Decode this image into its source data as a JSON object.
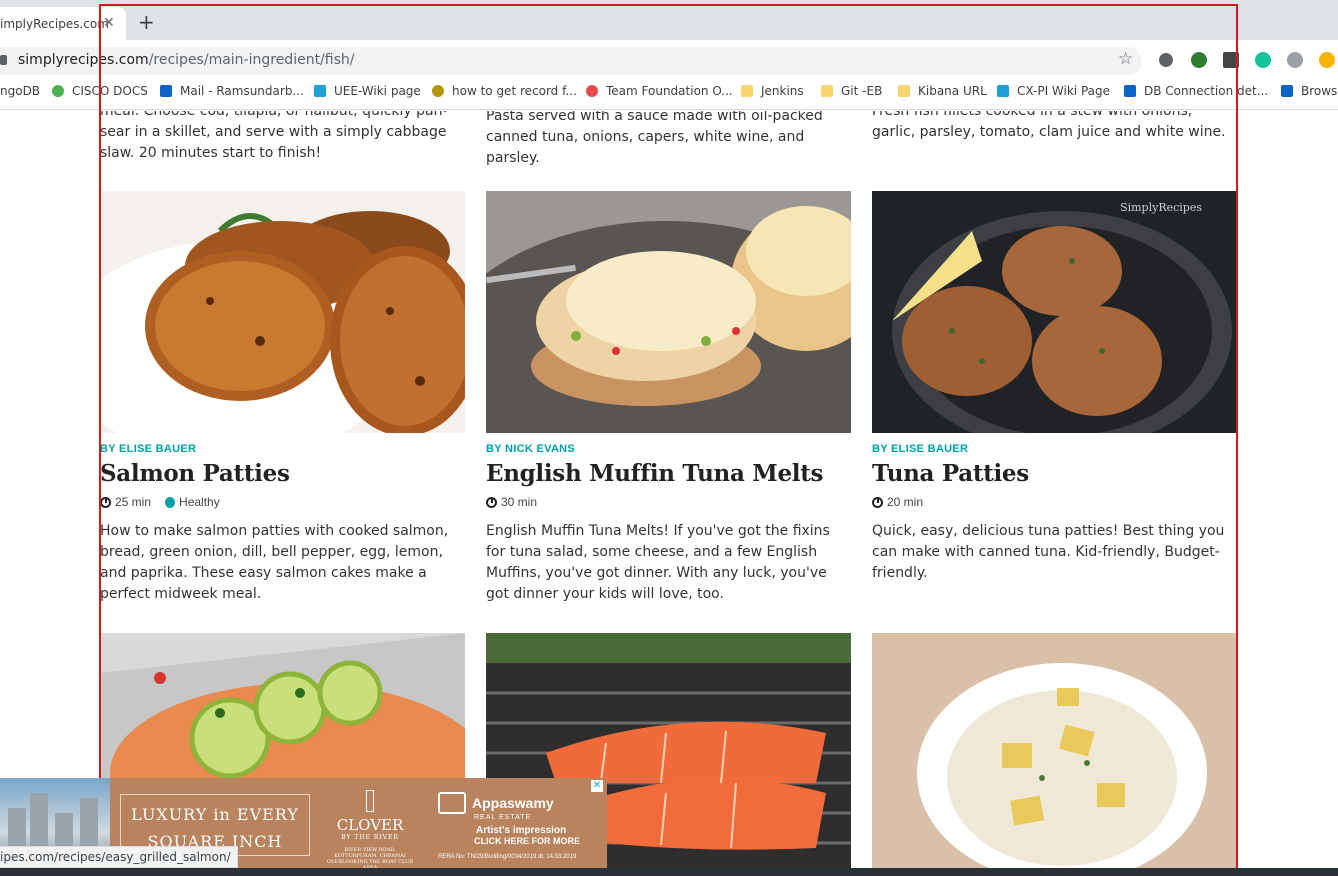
{
  "browser": {
    "tab_title": "implyRecipes.com",
    "tab_close": "✕",
    "new_tab": "+",
    "url_host": "simplyrecipes.com",
    "url_path": "/recipes/main-ingredient/fish/",
    "star": "☆"
  },
  "bookmarks": [
    {
      "label": "ngoDB",
      "color": "#4caf50"
    },
    {
      "label": "CISCO DOCS",
      "color": "#f4b400"
    },
    {
      "label": "Mail - Ramsundarb...",
      "color": "#0a64c8"
    },
    {
      "label": "UEE-Wiki page",
      "color": "#1ba0d7"
    },
    {
      "label": "how to get record f...",
      "color": "#b7950b"
    },
    {
      "label": "Team Foundation O...",
      "color": "#e44b4b"
    },
    {
      "label": "Jenkins",
      "color": "#f9d56e"
    },
    {
      "label": "Git -EB",
      "color": "#f9d56e"
    },
    {
      "label": "Kibana URL",
      "color": "#f9d56e"
    },
    {
      "label": "CX-PI Wiki Page",
      "color": "#1ba0d7"
    },
    {
      "label": "DB Connection det...",
      "color": "#0a64c8"
    },
    {
      "label": "Browse",
      "color": "#0a64c8"
    }
  ],
  "top_row": [
    {
      "desc": "meal. Choose cod, tilapia, or halibut, quickly pan-sear in a skillet, and serve with a simply cabbage slaw. 20 minutes start to finish!"
    },
    {
      "desc": "Pasta served with a sauce made with oil-packed canned tuna, onions, capers, white wine, and parsley."
    },
    {
      "desc": "Fresh fish fillets cooked in a stew with onions, garlic, parsley, tomato, clam juice and white wine."
    }
  ],
  "cards": [
    {
      "author": "BY ELISE BAUER",
      "title": "Salmon Patties",
      "time": "25 min",
      "tag": "Healthy",
      "desc": "How to make salmon patties with cooked salmon, bread, green onion, dill, bell pepper, egg, lemon, and paprika. These easy salmon cakes make a perfect midweek meal."
    },
    {
      "author": "BY NICK EVANS",
      "title": "English Muffin Tuna Melts",
      "time": "30 min",
      "desc": "English Muffin Tuna Melts! If you've got the fixins for tuna salad, some cheese, and a few English Muffins, you've got dinner. With any luck, you've got dinner your kids will love, too."
    },
    {
      "author": "BY ELISE BAUER",
      "title": "Tuna Patties",
      "time": "20 min",
      "desc": "Quick, easy, delicious tuna patties! Best thing you can make with canned tuna. Kid-friendly, Budget-friendly."
    }
  ],
  "watermark": "SimplyRecipes",
  "ad": {
    "line1": "LUXURY in EVERY",
    "line2": "SQUARE INCH",
    "clover": "CLOVER",
    "clover_sub": "BY THE RIVER",
    "clover_addr": "RIVER VIEW ROAD, KOTTURPURAM, CHENNAI",
    "clover_addr2": "OVERLOOKING THE BOAT CLUB AREA",
    "brand": "Appaswamy",
    "brand_sub": "REAL ESTATE",
    "cta1": "Artist's impression",
    "cta2": "CLICK HERE FOR MORE",
    "rera": "RERA No: TN/29/Building/0034/2019 dt. 14.03.2019",
    "close": "✕"
  },
  "status_url": "ipes.com/recipes/easy_grilled_salmon/"
}
